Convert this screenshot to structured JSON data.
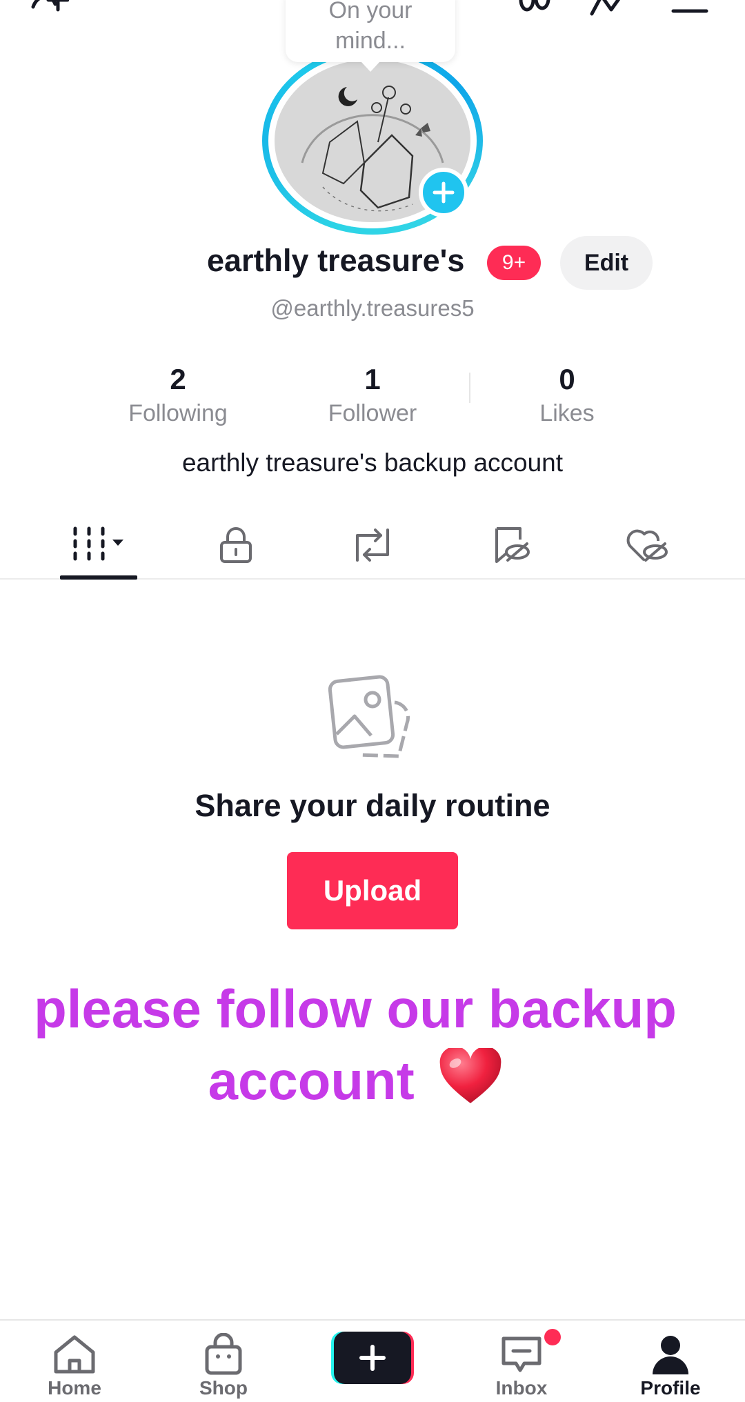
{
  "bubble": {
    "line1": "On your",
    "line2": "mind..."
  },
  "profile": {
    "display_name": "earthly treasure's",
    "notification_badge": "9+",
    "edit_label": "Edit",
    "username": "@earthly.treasures5",
    "bio": "earthly treasure's backup account"
  },
  "stats": [
    {
      "value": "2",
      "label": "Following"
    },
    {
      "value": "1",
      "label": "Follower"
    },
    {
      "value": "0",
      "label": "Likes"
    }
  ],
  "tabs": {
    "icons": [
      "videos-grid-icon",
      "lock-icon",
      "repost-icon",
      "bookmark-hidden-icon",
      "liked-hidden-icon"
    ],
    "active_index": 0
  },
  "empty_state": {
    "title": "Share your daily routine",
    "upload_label": "Upload"
  },
  "overlay": {
    "line1": "please follow our backup",
    "line2": "account",
    "emoji": "❤️"
  },
  "bottom_nav": {
    "home": "Home",
    "shop": "Shop",
    "inbox": "Inbox",
    "profile": "Profile"
  },
  "colors": {
    "accent_red": "#fe2c55",
    "ring_cyan": "#20c4ef",
    "overlay_purple": "#c63ae8"
  }
}
